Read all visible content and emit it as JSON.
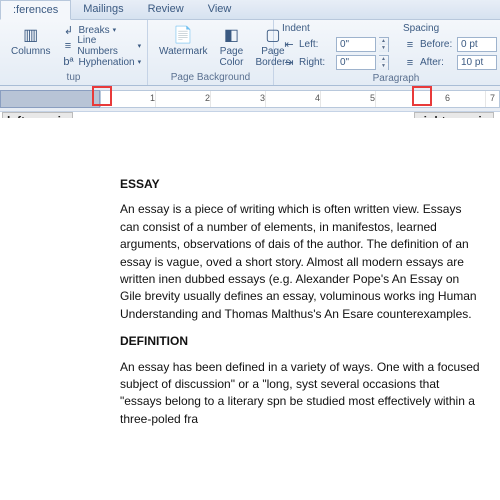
{
  "tabs": {
    "t0": ":ferences",
    "t1": "Mailings",
    "t2": "Review",
    "t3": "View"
  },
  "setup": {
    "columns": "Columns",
    "breaks": "Breaks",
    "lineNumbers": "Line Numbers",
    "hyphenation": "Hyphenation",
    "groupLabel": "tup"
  },
  "pagebg": {
    "watermark": "Watermark",
    "pageColor": "Page\nColor",
    "pageBorders": "Page\nBorders",
    "groupLabel": "Page Background"
  },
  "indent": {
    "title": "Indent",
    "leftLabel": "Left:",
    "rightLabel": "Right:",
    "leftVal": "0\"",
    "rightVal": "0\""
  },
  "spacing": {
    "title": "Spacing",
    "beforeLabel": "Before:",
    "afterLabel": "After:",
    "beforeVal": "0 pt",
    "afterVal": "10 pt"
  },
  "para": {
    "groupLabel": "Paragraph"
  },
  "ruler": {
    "n1": "1",
    "n2": "2",
    "n3": "3",
    "n4": "4",
    "n5": "5",
    "n6": "6",
    "n7": "7"
  },
  "annot": {
    "left": "left margin",
    "right": "right margin"
  },
  "doc": {
    "h1": "ESSAY",
    "p1": "An essay is a piece of writing which is often written view. Essays can consist of a number of elements, in manifestos, learned arguments, observations of dais of the author. The definition of an essay is vague, oved a short story. Almost all modern essays are written inen dubbed essays (e.g. Alexander Pope's An Essay on Gile brevity usually defines an essay, voluminous works ing Human Understanding and Thomas Malthus's An Esare counterexamples.",
    "h2": "DEFINITION",
    "p2": "An essay has been defined in a variety of ways. One with a focused subject of discussion\" or a \"long, syst several occasions that \"essays belong to a literary spn be studied most effectively within a three-poled fra"
  }
}
